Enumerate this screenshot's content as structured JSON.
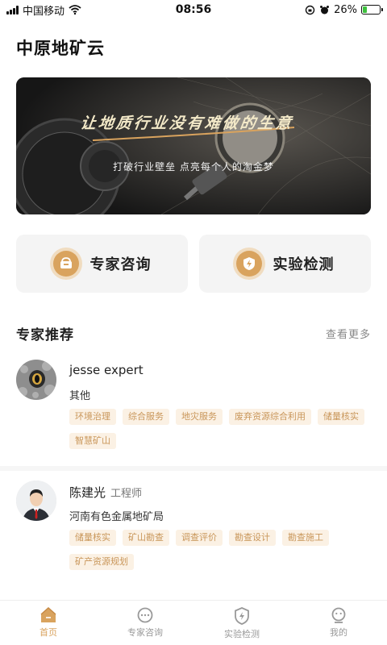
{
  "status_bar": {
    "carrier": "中国移动",
    "time": "08:56",
    "battery": "26%",
    "battery_level": 0.26
  },
  "header": {
    "title": "中原地矿云"
  },
  "banner": {
    "slogan": "让地质行业没有难做的生意",
    "subtitle": "打破行业壁垒  点亮每个人的淘金梦"
  },
  "quick_entries": [
    {
      "label": "专家咨询",
      "icon": "consult-icon"
    },
    {
      "label": "实验检测",
      "icon": "shield-lightning-icon"
    }
  ],
  "experts_section": {
    "title": "专家推荐",
    "more": "查看更多",
    "experts": [
      {
        "name": "jesse expert",
        "title": "",
        "org": "其他",
        "tags": [
          "环境治理",
          "综合服务",
          "地灾服务",
          "废弃资源综合利用",
          "储量核实",
          "智慧矿山"
        ]
      },
      {
        "name": "陈建光",
        "title": "工程师",
        "org": "河南有色金属地矿局",
        "tags": [
          "储量核实",
          "矿山勘查",
          "调查评价",
          "勘查设计",
          "勘查施工",
          "矿产资源规划"
        ]
      }
    ]
  },
  "tabbar": {
    "items": [
      {
        "label": "首页",
        "icon": "home-icon",
        "active": true
      },
      {
        "label": "专家咨询",
        "icon": "chat-icon",
        "active": false
      },
      {
        "label": "实验检测",
        "icon": "shield-lightning-icon",
        "active": false
      },
      {
        "label": "我的",
        "icon": "user-icon",
        "active": false
      }
    ],
    "accent": "#d9a35e"
  }
}
